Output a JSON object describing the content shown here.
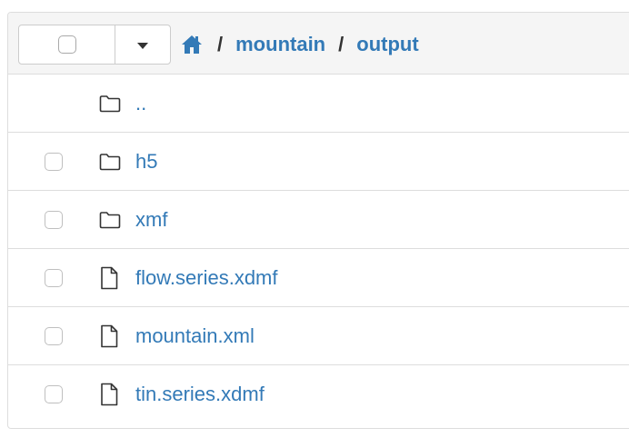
{
  "toolbar": {
    "select_all_checked": false,
    "dropdown_icon": "caret-down-icon"
  },
  "breadcrumb": {
    "home_icon": "home-icon",
    "separator": "/",
    "items": [
      "mountain",
      "output"
    ]
  },
  "colors": {
    "link": "#337ab7",
    "border": "#dddddd",
    "header_bg": "#f5f5f5"
  },
  "files": [
    {
      "name": "..",
      "type": "folder",
      "icon": "folder-icon",
      "has_checkbox": false
    },
    {
      "name": "h5",
      "type": "folder",
      "icon": "folder-icon",
      "has_checkbox": true
    },
    {
      "name": "xmf",
      "type": "folder",
      "icon": "folder-icon",
      "has_checkbox": true
    },
    {
      "name": "flow.series.xdmf",
      "type": "file",
      "icon": "file-icon",
      "has_checkbox": true
    },
    {
      "name": "mountain.xml",
      "type": "file",
      "icon": "file-icon",
      "has_checkbox": true
    },
    {
      "name": "tin.series.xdmf",
      "type": "file",
      "icon": "file-icon",
      "has_checkbox": true
    }
  ]
}
